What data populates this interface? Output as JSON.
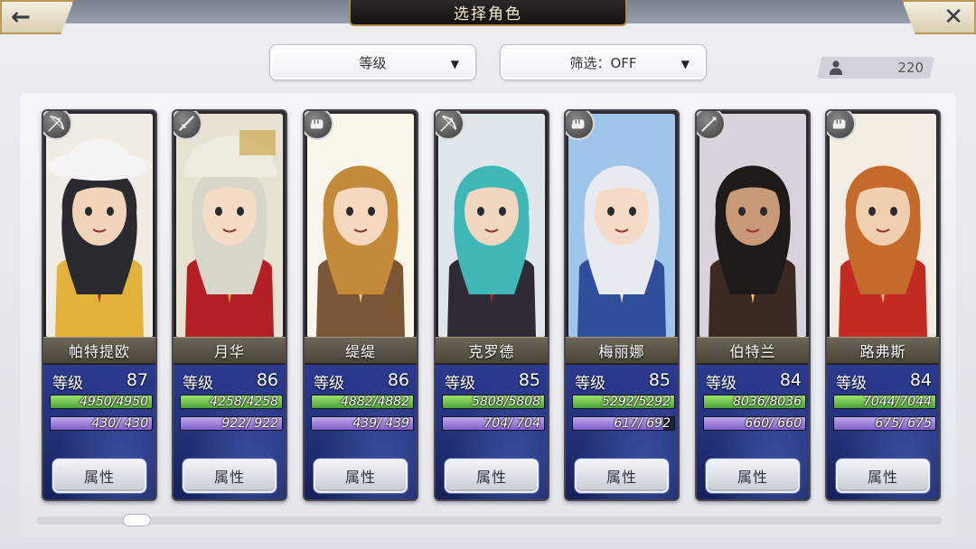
{
  "header": {
    "title": "选择角色",
    "back_icon": "←",
    "close_icon": "✕"
  },
  "sort": {
    "label": "等级",
    "arrow": "▼"
  },
  "filter": {
    "label": "筛选：OFF",
    "arrow": "▼"
  },
  "roster_count": "220",
  "level_label": "等级",
  "attr_label": "属性",
  "characters": [
    {
      "name": "帕特提欧",
      "level": "87",
      "hp": "4950/4950",
      "mp": " 430/ 430",
      "hp_frac": 1.0,
      "mp_frac": 1.0,
      "class_icon": "bow-icon",
      "palette": {
        "bg": "#f0ece4",
        "hair": "#2a2a30",
        "skin": "#f2d4bb",
        "hat": "#f4f4f4",
        "coat": "#e2b23a",
        "tie": "#9c2a25"
      }
    },
    {
      "name": "月华",
      "level": "86",
      "hp": "4258/4258",
      "mp": " 922/ 922",
      "hp_frac": 1.0,
      "mp_frac": 1.0,
      "class_icon": "sword-icon",
      "palette": {
        "bg": "#e8e2d2",
        "hair": "#d8d6c8",
        "skin": "#f5dcc6",
        "hat": "#f0ebe0",
        "coat": "#b21f24",
        "tie": "#c8a038"
      }
    },
    {
      "name": "缇缇",
      "level": "86",
      "hp": "4882/4882",
      "mp": " 439/ 439",
      "hp_frac": 1.0,
      "mp_frac": 1.0,
      "class_icon": "fist-icon",
      "palette": {
        "bg": "#fbf6ec",
        "hair": "#c48a3c",
        "skin": "#f6d8bf",
        "hat": "#fbf6ec",
        "coat": "#7a5634",
        "tie": "#e2c58a"
      }
    },
    {
      "name": "克罗德",
      "level": "85",
      "hp": "5808/5808",
      "mp": " 704/ 704",
      "hp_frac": 1.0,
      "mp_frac": 1.0,
      "class_icon": "bow-icon",
      "palette": {
        "bg": "#dfe6ec",
        "hair": "#3fb7b6",
        "skin": "#f1d6c0",
        "hat": "#dfe6ec",
        "coat": "#2f2b36",
        "tie": "#a32a2e"
      }
    },
    {
      "name": "梅丽娜",
      "level": "85",
      "hp": "5292/5292",
      "mp": " 617/ 692",
      "hp_frac": 1.0,
      "mp_frac": 0.89,
      "class_icon": "fist-icon",
      "palette": {
        "bg": "#9fc6ea",
        "hair": "#e8eaf2",
        "skin": "#f6dcc8",
        "hat": "#2f4f9a",
        "coat": "#2f4f9a",
        "tie": "#e8e2d2"
      }
    },
    {
      "name": "伯特兰",
      "level": "84",
      "hp": "8036/8036",
      "mp": " 660/ 660",
      "hp_frac": 1.0,
      "mp_frac": 1.0,
      "class_icon": "spear-icon",
      "palette": {
        "bg": "#d9d2dc",
        "hair": "#1e1a18",
        "skin": "#c89a78",
        "hat": "#d9d2dc",
        "coat": "#3a2a22",
        "tie": "#e8c878"
      }
    },
    {
      "name": "路弗斯",
      "level": "84",
      "hp": "7044/7044",
      "mp": " 675/ 675",
      "hp_frac": 1.0,
      "mp_frac": 1.0,
      "class_icon": "fist-icon",
      "palette": {
        "bg": "#f3ece2",
        "hair": "#c46a2c",
        "skin": "#f0cfae",
        "hat": "#f3ece2",
        "coat": "#c32a22",
        "tie": "#e7c27a"
      }
    }
  ]
}
